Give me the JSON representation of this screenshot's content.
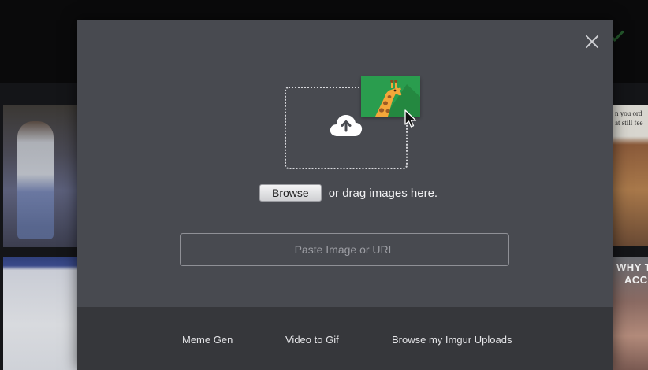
{
  "background": {
    "tile_top_right_text": [
      "n you ord",
      "at still fee"
    ],
    "tile_bottom_right_text": [
      "WHY TH",
      "ACC"
    ]
  },
  "upload_modal": {
    "browse_label": "Browse",
    "drag_text": "or drag images here.",
    "url_placeholder": "Paste Image or URL",
    "footer_links": [
      "Meme Gen",
      "Video to Gif",
      "Browse my Imgur Uploads"
    ]
  },
  "icons": {
    "close": "close-icon",
    "upload": "cloud-upload-icon",
    "giraffe": "giraffe-icon",
    "cursor": "cursor-icon"
  },
  "colors": {
    "modal_bg": "#484a50",
    "footer_bg": "#36373b",
    "giraffe_card": "#2a9d4e"
  }
}
